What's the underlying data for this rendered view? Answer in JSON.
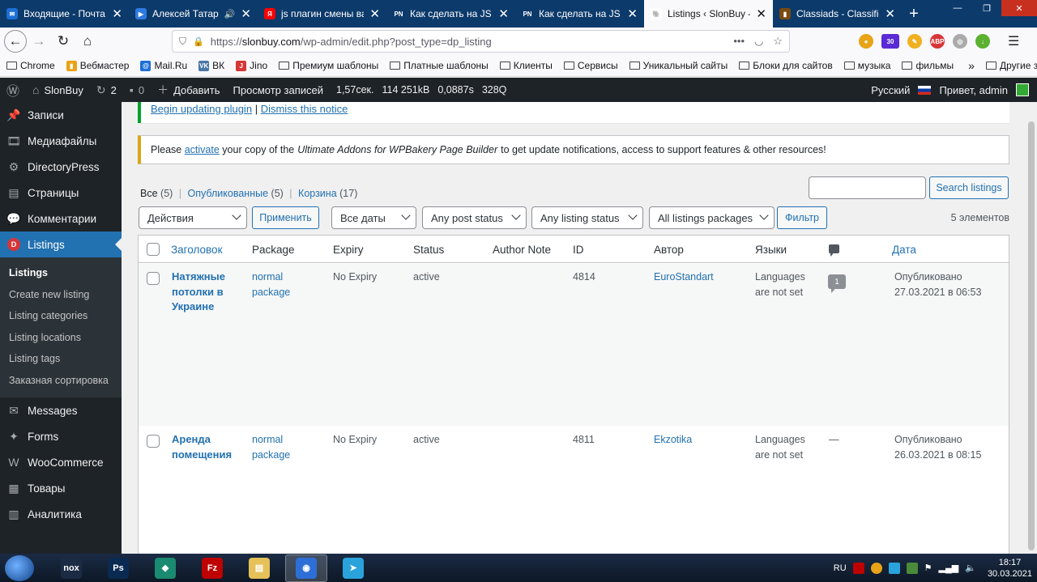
{
  "tabs": [
    {
      "title": "Входящие - Почта Mail.ru",
      "fav_color": "#1d6fd6",
      "fav_text": "✉",
      "active": false
    },
    {
      "title": "Алексей Татаринов",
      "fav_color": "#2d7ae3",
      "fav_text": "▶",
      "active": false,
      "audio": "🔊"
    },
    {
      "title": "js плагин смены валюты",
      "fav_color": "#ff0000",
      "fav_text": "Я",
      "active": false
    },
    {
      "title": "Как сделать на JS конвертер",
      "fav_color": "#0c3a6b",
      "fav_text": "PN",
      "active": false
    },
    {
      "title": "Как сделать на JS конвертер",
      "fav_color": "#0c3a6b",
      "fav_text": "PN",
      "active": false
    },
    {
      "title": "Listings ‹ SlonBuy — WordPress",
      "fav_color": "#ffffff",
      "fav_text": "🐘",
      "active": true
    },
    {
      "title": "Classiads - Classified Ads",
      "fav_color": "#7a4a10",
      "fav_text": "▮",
      "active": false
    }
  ],
  "browser": {
    "url_prefix": "https://",
    "url_host": "slonbuy.com",
    "url_path": "/wp-admin/edit.php?post_type=dp_listing",
    "ext_badge": "30",
    "ext_abp": "ABP"
  },
  "bookmarks": [
    {
      "label": "Chrome",
      "type": "folder"
    },
    {
      "label": "Вебмастер",
      "type": "icon",
      "color": "#e8a317",
      "glyph": "▮"
    },
    {
      "label": "Mail.Ru",
      "type": "icon",
      "color": "#1d6fd6",
      "glyph": "@"
    },
    {
      "label": "ВК",
      "type": "icon",
      "color": "#4a76a8",
      "glyph": "VK"
    },
    {
      "label": "Jino",
      "type": "icon",
      "color": "#d63638",
      "glyph": "J"
    },
    {
      "label": "Премиум шаблоны",
      "type": "folder"
    },
    {
      "label": "Платные шаблоны",
      "type": "folder"
    },
    {
      "label": "Клиенты",
      "type": "folder"
    },
    {
      "label": "Сервисы",
      "type": "folder"
    },
    {
      "label": "Уникальный сайты",
      "type": "folder"
    },
    {
      "label": "Блоки для сайтов",
      "type": "folder"
    },
    {
      "label": "музыка",
      "type": "folder"
    },
    {
      "label": "фильмы",
      "type": "folder"
    }
  ],
  "bookmarks_more": "»",
  "bookmarks_other": "Другие закладки",
  "adminbar": {
    "site": "SlonBuy",
    "updates": "2",
    "comments": "0",
    "add": "Добавить",
    "view": "Просмотр записей",
    "time": "1,57сек.",
    "mem": "114 251kB",
    "q1": "0,0887s",
    "q2": "328Q",
    "lang": "Русский",
    "greeting": "Привет, admin"
  },
  "sidebar": {
    "items_top": [
      {
        "label": "Записи",
        "icon": "📌"
      },
      {
        "label": "Медиафайлы",
        "icon": "🎞"
      },
      {
        "label": "DirectoryPress",
        "icon": "⚙"
      },
      {
        "label": "Страницы",
        "icon": "▤"
      },
      {
        "label": "Комментарии",
        "icon": "💬"
      }
    ],
    "current": {
      "label": "Listings",
      "icon": "D"
    },
    "sub": [
      {
        "label": "Listings",
        "current": true
      },
      {
        "label": "Create new listing"
      },
      {
        "label": "Listing categories"
      },
      {
        "label": "Listing locations"
      },
      {
        "label": "Listing tags"
      },
      {
        "label": "Заказная сортировка"
      }
    ],
    "items_bottom": [
      {
        "label": "Messages",
        "icon": "✉"
      },
      {
        "label": "Forms",
        "icon": "✦"
      },
      {
        "label": "WooCommerce",
        "icon": "W"
      },
      {
        "label": "Товары",
        "icon": "▦"
      },
      {
        "label": "Аналитика",
        "icon": "▥"
      }
    ]
  },
  "notices": {
    "update_link": "Begin updating plugin",
    "sep": "|",
    "dismiss_link": "Dismiss this notice",
    "n2_pre": "Please",
    "n2_link": "activate",
    "n2_mid": "your copy of the",
    "n2_italic": "Ultimate Addons for WPBakery Page Builder",
    "n2_post": "to get update notifications, access to support features & other resources!"
  },
  "views": {
    "all": "Все",
    "all_count": "(5)",
    "published": "Опубликованные",
    "published_count": "(5)",
    "trash": "Корзина",
    "trash_count": "(17)",
    "sep": "|"
  },
  "filters": {
    "bulk": "Действия",
    "apply": "Применить",
    "dates": "Все даты",
    "post_status": "Any post status",
    "listing_status": "Any listing status",
    "packages": "All listings packages",
    "filter": "Фильтр",
    "search_btn": "Search listings",
    "count": "5 элементов"
  },
  "columns": {
    "title": "Заголовок",
    "package": "Package",
    "expiry": "Expiry",
    "status": "Status",
    "note": "Author Note",
    "id": "ID",
    "author": "Автор",
    "langs": "Языки",
    "date": "Дата"
  },
  "rows": [
    {
      "title": "Натяжные потолки в Украине",
      "package": "normal package",
      "expiry": "No Expiry",
      "status": "active",
      "id": "4814",
      "author": "EuroStandart",
      "langs": "Languages are not set",
      "comments": "1",
      "date_status": "Опубликовано",
      "date": "27.03.2021 в 06:53"
    },
    {
      "title": "Аренда помещения",
      "package": "normal package",
      "expiry": "No Expiry",
      "status": "active",
      "id": "4811",
      "author": "Ekzotika",
      "langs": "Languages are not set",
      "comments": "—",
      "date_status": "Опубликовано",
      "date": "26.03.2021 в 08:15"
    }
  ],
  "taskbar": {
    "lang": "RU",
    "time": "18:17",
    "date": "30.03.2021",
    "apps": [
      {
        "name": "nox",
        "color": "#1b2b44",
        "text": "nox"
      },
      {
        "name": "photoshop",
        "color": "#0a2a52",
        "text": "Ps"
      },
      {
        "name": "phpstorm",
        "color": "#1a8a70",
        "text": "◆"
      },
      {
        "name": "filezilla",
        "color": "#bf0000",
        "text": "Fz"
      },
      {
        "name": "explorer",
        "color": "#e6c15a",
        "text": "▤"
      },
      {
        "name": "firefox",
        "color": "#2d6fd6",
        "text": "◉",
        "active": true
      },
      {
        "name": "telegram",
        "color": "#2aa3dc",
        "text": "➤"
      }
    ]
  }
}
